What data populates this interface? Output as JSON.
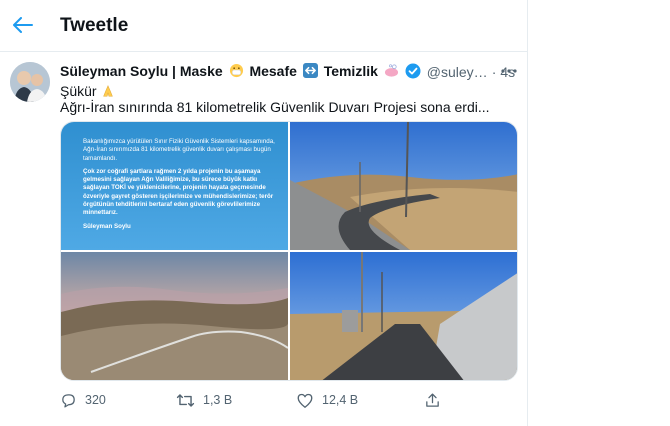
{
  "header": {
    "title": "Tweetle",
    "back_icon": "arrow-left-icon"
  },
  "tweet": {
    "author_name": "Süleyman Soylu | Maske",
    "author_name_part2": "Mesafe",
    "author_name_part3": "Temizlik",
    "handle": "@suley…",
    "separator": "·",
    "time": "4s",
    "line1": "Şükür",
    "line2": "Ağrı-İran sınırında 81 kilometrelik Güvenlik Duvarı Projesi sona erdi...",
    "accent_color": "#1d9bf0"
  },
  "media": {
    "info_p1": "Bakanlığımızca yürütülen Sınır Fiziki Güvenlik Sistemleri kapsamında, Ağrı-İran sınırımızda 81 kilometrelik güvenlik duvarı çalışması bugün tamamlandı.",
    "info_p2": "Çok zor coğrafi şartlara rağmen 2 yılda projenin bu aşamaya gelmesini sağlayan Ağrı Valiliğimize, bu sürece büyük katkı sağlayan TOKİ ve yüklenicilerine, projenin hayata geçmesinde özveriyle gayret gösteren işçilerimize ve mühendislerimize; terör örgütünün tehditlerini bertaraf eden güvenlik görevlilerimize minnettarız.",
    "info_p3": "Süleyman Soylu"
  },
  "actions": {
    "reply_count": "320",
    "retweet_count": "1,3 B",
    "like_count": "12,4 B"
  }
}
